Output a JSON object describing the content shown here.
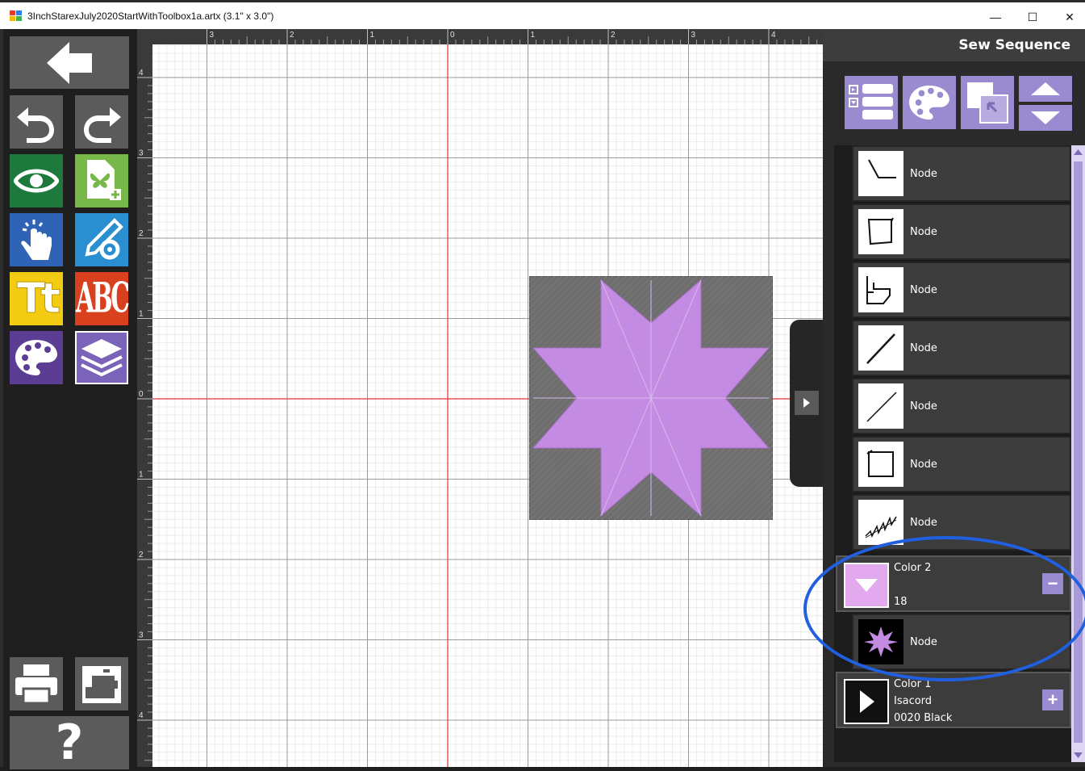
{
  "window": {
    "title": "3InchStarexJuly2020StartWithToolbox1a.artx (3.1\" x 3.0\")",
    "minimize_glyph": "—",
    "maximize_glyph": "☐",
    "close_glyph": "✕"
  },
  "toolbar": {
    "buttons": [
      {
        "name": "back-button",
        "icon": "arrow-left-icon"
      },
      {
        "name": "undo-button",
        "icon": "undo-icon"
      },
      {
        "name": "redo-button",
        "icon": "redo-icon"
      },
      {
        "name": "view-button",
        "icon": "eye-icon"
      },
      {
        "name": "add-design-button",
        "icon": "butterfly-file-plus-icon"
      },
      {
        "name": "select-button",
        "icon": "pointer-hand-icon"
      },
      {
        "name": "edit-button",
        "icon": "pencil-gear-icon"
      },
      {
        "name": "text-button",
        "icon": "text-tt-icon",
        "label": "Tt"
      },
      {
        "name": "monogram-button",
        "icon": "monogram-abc-icon",
        "label": "ABC"
      },
      {
        "name": "palette-button",
        "icon": "palette-icon"
      },
      {
        "name": "layers-button",
        "icon": "layers-icon"
      },
      {
        "name": "print-button",
        "icon": "printer-icon"
      },
      {
        "name": "sew-button",
        "icon": "sewing-machine-icon"
      },
      {
        "name": "help-button",
        "icon": "question-icon",
        "label": "?"
      }
    ]
  },
  "rulers": {
    "top_labels": [
      "3",
      "2",
      "1",
      "0",
      "1",
      "2",
      "3",
      "4"
    ],
    "left_labels": [
      "4",
      "3",
      "2",
      "1",
      "0",
      "1",
      "2",
      "3",
      "4"
    ]
  },
  "sew_sequence": {
    "title": "Sew Sequence",
    "tools": [
      "list-icon",
      "palette-icon",
      "overlap-icon",
      "move-up-down-icon"
    ],
    "rows": [
      {
        "type": "node",
        "label": "Node",
        "thumb": "corner-icon"
      },
      {
        "type": "node",
        "label": "Node",
        "thumb": "square-outline-icon"
      },
      {
        "type": "node",
        "label": "Node",
        "thumb": "steps-icon"
      },
      {
        "type": "node",
        "label": "Node",
        "thumb": "diagonal-line-icon"
      },
      {
        "type": "node",
        "label": "Node",
        "thumb": "diagonal-line-icon"
      },
      {
        "type": "node",
        "label": "Node",
        "thumb": "square-outline-icon"
      },
      {
        "type": "node",
        "label": "Node",
        "thumb": "zigzag-icon"
      },
      {
        "type": "color",
        "name": "Color 2",
        "line2": "",
        "line3": "18",
        "swatch": "#e3a9ef",
        "action": "−"
      },
      {
        "type": "node",
        "label": "Node",
        "thumb": "star-icon"
      },
      {
        "type": "color",
        "name": "Color 1",
        "line2": "Isacord",
        "line3": "0020 Black",
        "swatch": "#111111",
        "action": "+"
      }
    ]
  },
  "colors": {
    "accent": "#9a8bd0",
    "star_fill": "#c48be3",
    "background_fill": "#6e6e6e",
    "highlight": "#1f5fe0"
  }
}
